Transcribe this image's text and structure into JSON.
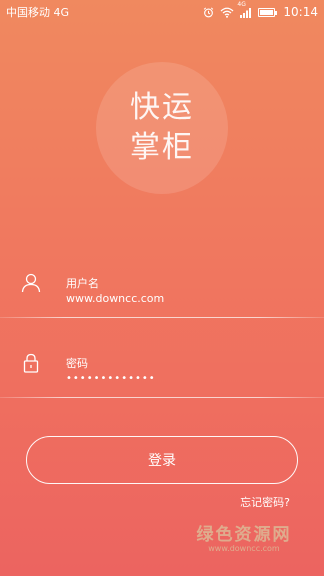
{
  "status_bar": {
    "carrier": "中国移动 4G",
    "network_badge": "4G",
    "time": "10:14",
    "icons": [
      "alarm-icon",
      "wifi-icon",
      "signal-icon",
      "battery-icon"
    ]
  },
  "logo": {
    "line1": "快运",
    "line2": "掌柜"
  },
  "username": {
    "label": "用户名",
    "value": "www.downcc.com",
    "icon": "user-icon"
  },
  "password": {
    "label": "密码",
    "value": "•••••••••••••",
    "icon": "lock-icon"
  },
  "login_button": "登录",
  "forgot_password": "忘记密码?",
  "watermark": {
    "text": "绿色资源网",
    "sub": "www.downcc.com"
  },
  "colors": {
    "gradient_top": "#f0895f",
    "gradient_bottom": "#ec6460",
    "text": "#ffffff"
  }
}
